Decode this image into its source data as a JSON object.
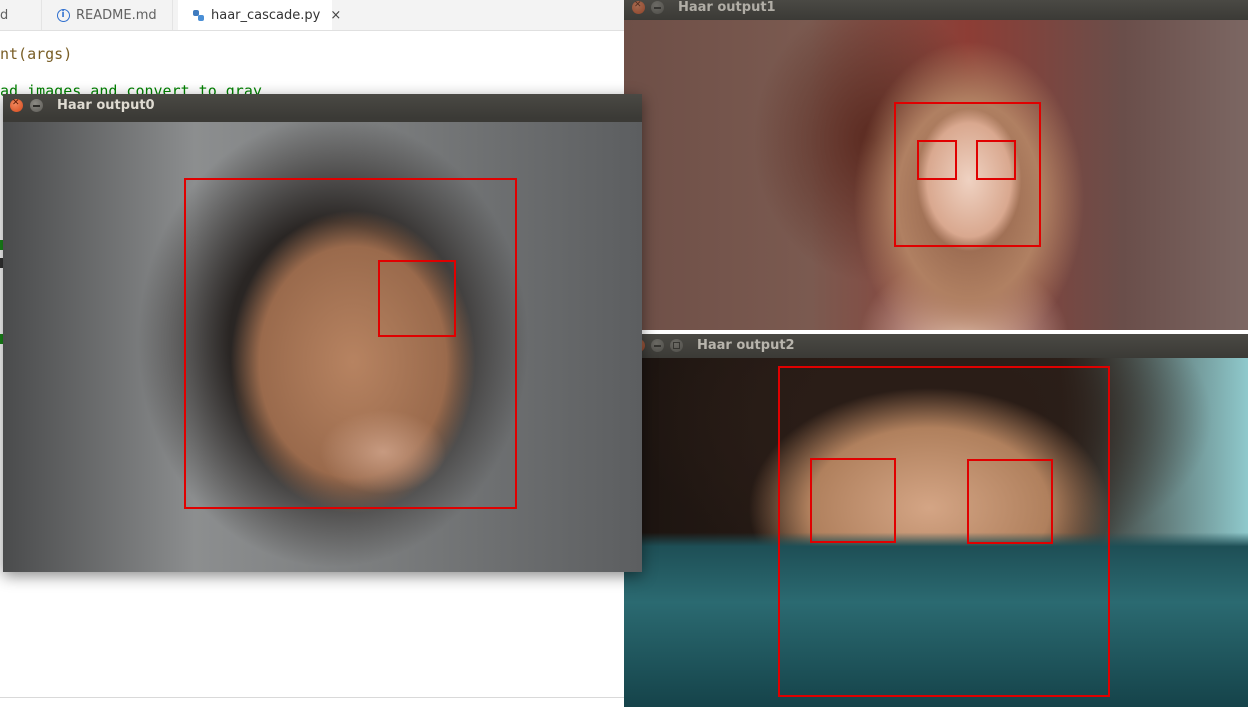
{
  "editor": {
    "tabs": [
      {
        "label": "d",
        "icon": "file-icon"
      },
      {
        "label": "README.md",
        "icon": "info-icon"
      },
      {
        "label": "haar_cascade.py",
        "icon": "python-icon",
        "close": "×",
        "active": true
      }
    ],
    "code_lines": [
      "nt(args)",
      "ad images and convert to gray"
    ]
  },
  "windows": [
    {
      "title": "Haar output0",
      "detections": {
        "faces": 1,
        "eyes": 1
      }
    },
    {
      "title": "Haar output1",
      "detections": {
        "faces": 1,
        "eyes": 2
      }
    },
    {
      "title": "Haar output2",
      "detections": {
        "faces": 1,
        "eyes": 2
      }
    }
  ],
  "colors": {
    "detection_box": "#e00000",
    "titlebar": "#3b3a36",
    "title_text": "#dfdbd2",
    "close_button": "#d4481b"
  }
}
